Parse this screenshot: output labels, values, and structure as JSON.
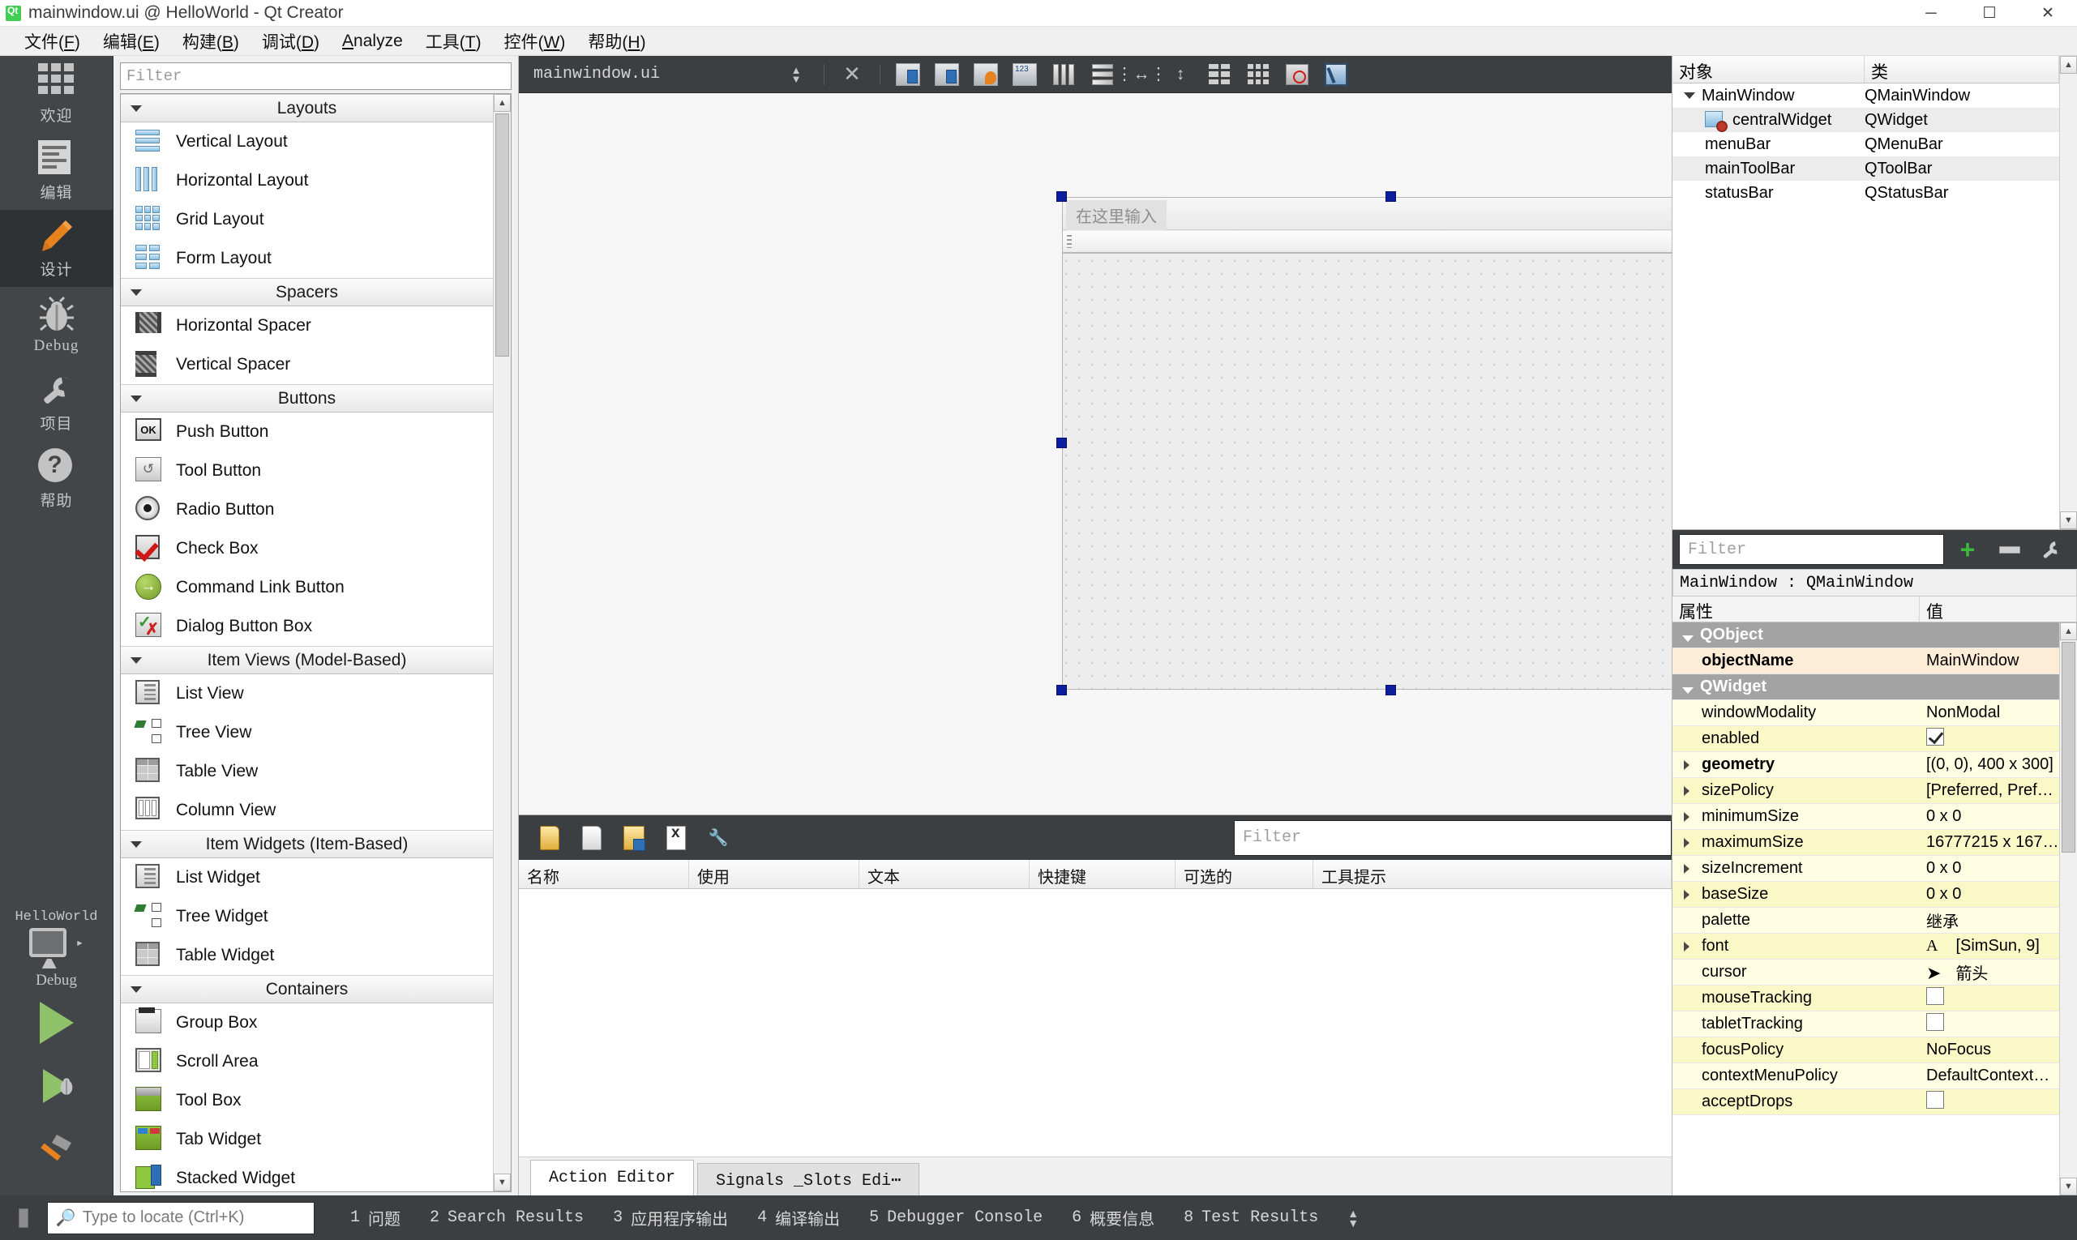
{
  "window": {
    "title": "mainwindow.ui @ HelloWorld - Qt Creator",
    "app_icon": "qt-logo-icon",
    "minimize": "─",
    "maximize": "☐",
    "close": "✕"
  },
  "menubar": {
    "items": [
      {
        "label": "文件(F)",
        "mnemonic": "F"
      },
      {
        "label": "编辑(E)",
        "mnemonic": "E"
      },
      {
        "label": "构建(B)",
        "mnemonic": "B"
      },
      {
        "label": "调试(D)",
        "mnemonic": "D"
      },
      {
        "label": "Analyze",
        "mnemonic": "A"
      },
      {
        "label": "工具(T)",
        "mnemonic": "T"
      },
      {
        "label": "控件(W)",
        "mnemonic": "W"
      },
      {
        "label": "帮助(H)",
        "mnemonic": "H"
      }
    ]
  },
  "modebar": {
    "items": [
      {
        "label": "欢迎",
        "icon": "grid-icon",
        "active": false
      },
      {
        "label": "编辑",
        "icon": "document-icon",
        "active": false
      },
      {
        "label": "设计",
        "icon": "pencil-icon",
        "active": true
      },
      {
        "label": "Debug",
        "icon": "bug-icon",
        "active": false
      },
      {
        "label": "项目",
        "icon": "wrench-icon",
        "active": false
      },
      {
        "label": "帮助",
        "icon": "question-icon",
        "active": false
      }
    ],
    "kit": {
      "project": "HelloWorld",
      "config": "Debug",
      "arrow": "▸"
    },
    "run_buttons": [
      {
        "name": "run-button",
        "icon": "play-icon"
      },
      {
        "name": "debug-button",
        "icon": "play-bug-icon"
      },
      {
        "name": "build-button",
        "icon": "hammer-icon"
      }
    ]
  },
  "widgetbox": {
    "filter_placeholder": "Filter",
    "filter_value": "",
    "categories": [
      {
        "name": "Layouts",
        "items": [
          {
            "label": "Vertical Layout",
            "icon": "vertical-layout-icon"
          },
          {
            "label": "Horizontal Layout",
            "icon": "horizontal-layout-icon"
          },
          {
            "label": "Grid Layout",
            "icon": "grid-layout-icon"
          },
          {
            "label": "Form Layout",
            "icon": "form-layout-icon"
          }
        ]
      },
      {
        "name": "Spacers",
        "items": [
          {
            "label": "Horizontal Spacer",
            "icon": "horizontal-spacer-icon"
          },
          {
            "label": "Vertical Spacer",
            "icon": "vertical-spacer-icon"
          }
        ]
      },
      {
        "name": "Buttons",
        "items": [
          {
            "label": "Push Button",
            "icon": "push-button-icon"
          },
          {
            "label": "Tool Button",
            "icon": "tool-button-icon"
          },
          {
            "label": "Radio Button",
            "icon": "radio-button-icon"
          },
          {
            "label": "Check Box",
            "icon": "check-box-icon"
          },
          {
            "label": "Command Link Button",
            "icon": "command-link-icon"
          },
          {
            "label": "Dialog Button Box",
            "icon": "dialog-button-box-icon"
          }
        ]
      },
      {
        "name": "Item Views (Model-Based)",
        "items": [
          {
            "label": "List View",
            "icon": "list-view-icon"
          },
          {
            "label": "Tree View",
            "icon": "tree-view-icon"
          },
          {
            "label": "Table View",
            "icon": "table-view-icon"
          },
          {
            "label": "Column View",
            "icon": "column-view-icon"
          }
        ]
      },
      {
        "name": "Item Widgets (Item-Based)",
        "items": [
          {
            "label": "List Widget",
            "icon": "list-widget-icon"
          },
          {
            "label": "Tree Widget",
            "icon": "tree-widget-icon"
          },
          {
            "label": "Table Widget",
            "icon": "table-widget-icon"
          }
        ]
      },
      {
        "name": "Containers",
        "items": [
          {
            "label": "Group Box",
            "icon": "group-box-icon"
          },
          {
            "label": "Scroll Area",
            "icon": "scroll-area-icon"
          },
          {
            "label": "Tool Box",
            "icon": "tool-box-icon"
          },
          {
            "label": "Tab Widget",
            "icon": "tab-widget-icon"
          },
          {
            "label": "Stacked Widget",
            "icon": "stacked-widget-icon"
          }
        ]
      }
    ]
  },
  "editorbar": {
    "filename": "mainwindow.ui",
    "split_icon": "up-down-arrows-icon",
    "close_icon": "close-x-icon",
    "tools": [
      {
        "name": "edit-widgets-tool",
        "icon": "edit-widgets-icon"
      },
      {
        "name": "edit-signals-slots-tool",
        "icon": "edit-signals-slots-icon"
      },
      {
        "name": "edit-buddies-tool",
        "icon": "edit-buddies-icon"
      },
      {
        "name": "edit-tab-order-tool",
        "icon": "edit-tab-order-icon"
      },
      {
        "name": "layout-horizontally-tool",
        "icon": "layout-horizontal-icon"
      },
      {
        "name": "layout-vertically-tool",
        "icon": "layout-vertical-icon"
      },
      {
        "name": "layout-splitter-horizontal-tool",
        "icon": "splitter-horizontal-icon"
      },
      {
        "name": "layout-splitter-vertical-tool",
        "icon": "splitter-vertical-icon"
      },
      {
        "name": "layout-form-tool",
        "icon": "layout-form-icon"
      },
      {
        "name": "layout-grid-tool",
        "icon": "layout-grid-icon"
      },
      {
        "name": "break-layout-tool",
        "icon": "break-layout-icon"
      },
      {
        "name": "preview-tool",
        "icon": "preview-icon"
      }
    ]
  },
  "form": {
    "menu_placeholder": "在这里输入"
  },
  "action_editor": {
    "toolbar": [
      {
        "name": "new-action-button",
        "icon": "new-page-icon"
      },
      {
        "name": "copy-action-button",
        "icon": "copy-page-icon"
      },
      {
        "name": "paste-action-button",
        "icon": "paste-page-icon"
      },
      {
        "name": "delete-action-button",
        "icon": "delete-page-icon"
      },
      {
        "name": "configure-action-button",
        "icon": "wrench-small-icon"
      }
    ],
    "filter_placeholder": "Filter",
    "filter_value": "",
    "columns": [
      "名称",
      "使用",
      "文本",
      "快捷键",
      "可选的",
      "工具提示"
    ],
    "rows": [],
    "tabs": [
      {
        "label": "Action Editor",
        "active": true
      },
      {
        "label": "Signals _Slots Edi⋯",
        "active": false
      }
    ]
  },
  "object_inspector": {
    "columns": [
      "对象",
      "类"
    ],
    "rows": [
      {
        "name": "MainWindow",
        "class": "QMainWindow",
        "indent": 0,
        "expandable": true,
        "icon": "",
        "selected": false
      },
      {
        "name": "centralWidget",
        "class": "QWidget",
        "indent": 1,
        "expandable": false,
        "icon": "no-layout-icon",
        "selected": true
      },
      {
        "name": "menuBar",
        "class": "QMenuBar",
        "indent": 1,
        "expandable": false,
        "icon": "",
        "selected": false
      },
      {
        "name": "mainToolBar",
        "class": "QToolBar",
        "indent": 1,
        "expandable": false,
        "icon": "",
        "selected": true
      },
      {
        "name": "statusBar",
        "class": "QStatusBar",
        "indent": 1,
        "expandable": false,
        "icon": "",
        "selected": false
      }
    ]
  },
  "property_editor": {
    "filter_placeholder": "Filter",
    "filter_value": "",
    "add_button": "add-property-icon",
    "remove_button": "remove-property-icon",
    "configure_button": "configure-property-icon",
    "object_line": "MainWindow : QMainWindow",
    "columns": [
      "属性",
      "值"
    ],
    "rows": [
      {
        "name": "QObject",
        "value": "",
        "type": "group"
      },
      {
        "name": "objectName",
        "value": "MainWindow",
        "type": "highlight",
        "bold": true
      },
      {
        "name": "QWidget",
        "value": "",
        "type": "group"
      },
      {
        "name": "windowModality",
        "value": "NonModal",
        "type": "y0"
      },
      {
        "name": "enabled",
        "value": "",
        "type": "y1",
        "widget": "checkbox-checked"
      },
      {
        "name": "geometry",
        "value": "[(0, 0), 400 x 300]",
        "type": "y0",
        "expandable": true,
        "bold": true
      },
      {
        "name": "sizePolicy",
        "value": "[Preferred, Preferre...",
        "type": "y1",
        "expandable": true
      },
      {
        "name": "minimumSize",
        "value": "0 x 0",
        "type": "y0",
        "expandable": true
      },
      {
        "name": "maximumSize",
        "value": "16777215 x 16777...",
        "type": "y1",
        "expandable": true
      },
      {
        "name": "sizeIncrement",
        "value": "0 x 0",
        "type": "y0",
        "expandable": true
      },
      {
        "name": "baseSize",
        "value": "0 x 0",
        "type": "y1",
        "expandable": true
      },
      {
        "name": "palette",
        "value": "继承",
        "type": "y0"
      },
      {
        "name": "font",
        "value": "[SimSun, 9]",
        "type": "y1",
        "expandable": true,
        "widget": "font-icon"
      },
      {
        "name": "cursor",
        "value": "箭头",
        "type": "y0",
        "widget": "cursor-icon"
      },
      {
        "name": "mouseTracking",
        "value": "",
        "type": "y1",
        "widget": "checkbox-unchecked"
      },
      {
        "name": "tabletTracking",
        "value": "",
        "type": "y0",
        "widget": "checkbox-unchecked"
      },
      {
        "name": "focusPolicy",
        "value": "NoFocus",
        "type": "y1"
      },
      {
        "name": "contextMenuPolicy",
        "value": "DefaultContextMenu",
        "type": "y0"
      },
      {
        "name": "acceptDrops",
        "value": "",
        "type": "y1",
        "widget": "checkbox-unchecked"
      }
    ]
  },
  "statusbar": {
    "toggle_icon": "toggle-sidebar-icon",
    "locate_placeholder": "Type to locate (Ctrl+K)",
    "locate_value": "",
    "search_icon": "search-icon",
    "panes": [
      {
        "num": "1",
        "label": "问题"
      },
      {
        "num": "2",
        "label": "Search Results"
      },
      {
        "num": "3",
        "label": "应用程序输出"
      },
      {
        "num": "4",
        "label": "编译输出"
      },
      {
        "num": "5",
        "label": "Debugger Console"
      },
      {
        "num": "6",
        "label": "概要信息"
      },
      {
        "num": "8",
        "label": "Test Results"
      }
    ],
    "updown_icon": "up-down-arrows-icon"
  }
}
